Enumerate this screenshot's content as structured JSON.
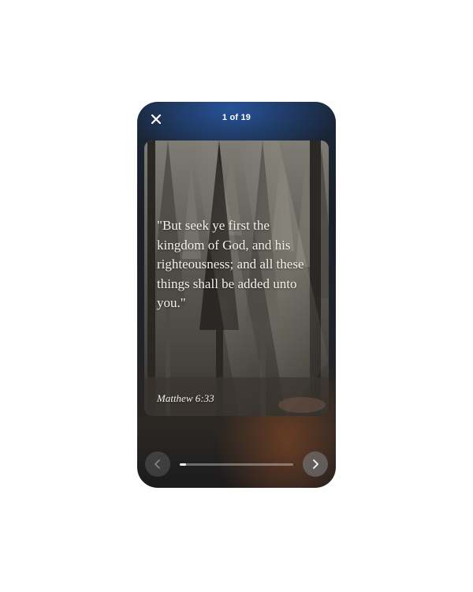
{
  "header": {
    "counter_text": "1 of 19"
  },
  "slide": {
    "verse_text": "\"But seek ye first the kingdom of God, and his righteousness; and all these things shall be added unto you.\"",
    "reference": "Matthew 6:33"
  },
  "progress": {
    "current": 1,
    "total": 19,
    "fraction": 0.0526
  },
  "icons": {
    "close": "close-icon",
    "previous": "chevron-left-icon",
    "next": "chevron-right-icon"
  },
  "colors": {
    "text": "#f4f1ea",
    "progress_fill": "#ffffff",
    "header_accent": "#285aaa"
  }
}
